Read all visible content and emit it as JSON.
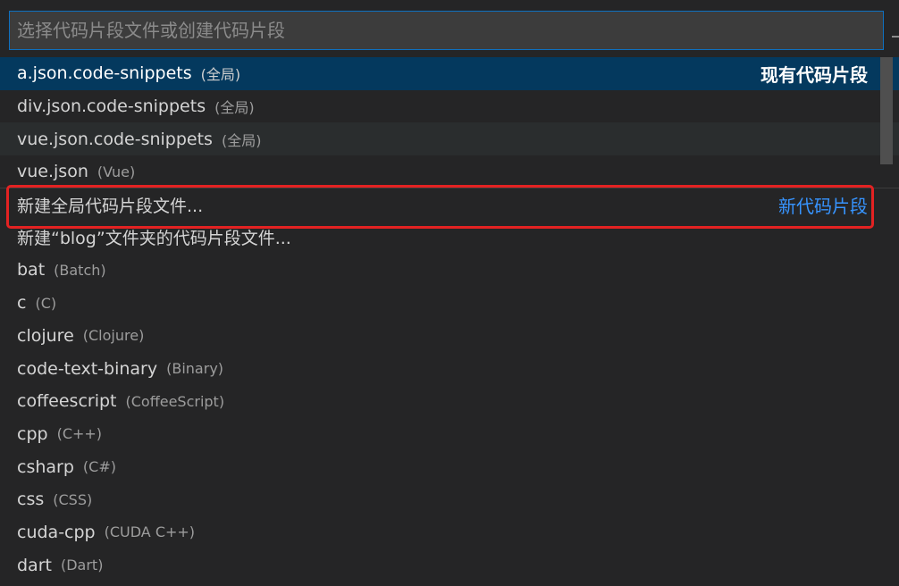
{
  "search": {
    "placeholder": "选择代码片段文件或创建代码片段"
  },
  "existing_group_label": "现有代码片段",
  "new_group_label": "新代码片段",
  "items": [
    {
      "label": "a.json.code-snippets",
      "desc": "(全局)"
    },
    {
      "label": "div.json.code-snippets",
      "desc": "(全局)"
    },
    {
      "label": "vue.json.code-snippets",
      "desc": "(全局)"
    },
    {
      "label": "vue.json",
      "desc": "(Vue)"
    },
    {
      "label": "新建全局代码片段文件...",
      "desc": ""
    },
    {
      "label": "新建“blog”文件夹的代码片段文件...",
      "desc": ""
    },
    {
      "label": "bat",
      "desc": "(Batch)"
    },
    {
      "label": "c",
      "desc": "(C)"
    },
    {
      "label": "clojure",
      "desc": "(Clojure)"
    },
    {
      "label": "code-text-binary",
      "desc": "(Binary)"
    },
    {
      "label": "coffeescript",
      "desc": "(CoffeeScript)"
    },
    {
      "label": "cpp",
      "desc": "(C++)"
    },
    {
      "label": "csharp",
      "desc": "(C#)"
    },
    {
      "label": "css",
      "desc": "(CSS)"
    },
    {
      "label": "cuda-cpp",
      "desc": "(CUDA C++)"
    },
    {
      "label": "dart",
      "desc": "(Dart)"
    }
  ],
  "colors": {
    "selection": "#04395e",
    "accent_link": "#3794ff",
    "highlight_border": "#e32222"
  }
}
